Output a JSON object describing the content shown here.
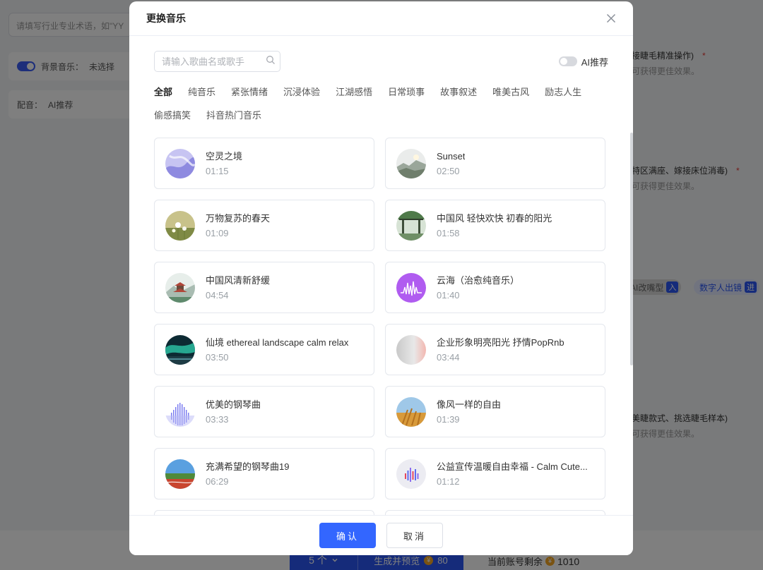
{
  "background": {
    "input_placeholder": "请填写行业专业术语，如\"YY",
    "music_label": "背景音乐：",
    "music_value": "未选择",
    "voice_label": "配音：",
    "voice_value": "AI推荐",
    "right_items": [
      {
        "text": "接睫毛精准操作)",
        "sub": "可获得更佳效果。"
      },
      {
        "text": "特区满座、嫁接床位消毒)",
        "sub": "可获得更佳效果。"
      },
      {
        "text": "美睫款式、挑选睫毛样本)",
        "sub": "可获得更佳效果。"
      }
    ],
    "tag_ai": "AI改嘴型",
    "tag_ai_badge": "入",
    "tag_digital": "数字人出镜",
    "tag_digital_badge": "进",
    "count_select": "5 个",
    "generate_label": "生成并预览",
    "generate_cost": "80",
    "balance_label": "当前账号剩余",
    "balance_value": "1010"
  },
  "modal": {
    "title": "更换音乐",
    "search_placeholder": "请输入歌曲名或歌手",
    "ai_recommend_label": "AI推荐",
    "ai_recommend_on": false,
    "categories": [
      "全部",
      "纯音乐",
      "紧张情绪",
      "沉浸体验",
      "江湖感悟",
      "日常琐事",
      "故事叙述",
      "唯美古风",
      "励志人生",
      "偷感搞笑",
      "抖音热门音乐"
    ],
    "active_category": "全部",
    "songs": [
      {
        "name": "空灵之境",
        "duration": "01:15",
        "cover": "ethereal"
      },
      {
        "name": "Sunset",
        "duration": "02:50",
        "cover": "sunset"
      },
      {
        "name": "万物复苏的春天",
        "duration": "01:09",
        "cover": "spring"
      },
      {
        "name": "中国风 轻快欢快 初春的阳光",
        "duration": "01:58",
        "cover": "pavilion"
      },
      {
        "name": "中国风清新舒缓",
        "duration": "04:54",
        "cover": "pagoda"
      },
      {
        "name": "云海（治愈纯音乐）",
        "duration": "01:40",
        "cover": "wave"
      },
      {
        "name": "仙境 ethereal landscape calm relax",
        "duration": "03:50",
        "cover": "aurora"
      },
      {
        "name": "企业形象明亮阳光 抒情PopRnb",
        "duration": "03:44",
        "cover": "gradient"
      },
      {
        "name": "优美的钢琴曲",
        "duration": "03:33",
        "cover": "piano"
      },
      {
        "name": "像风一样的自由",
        "duration": "01:39",
        "cover": "wheat"
      },
      {
        "name": "充满希望的钢琴曲19",
        "duration": "06:29",
        "cover": "field"
      },
      {
        "name": "公益宣传温暖自由幸福 - Calm Cute...",
        "duration": "01:12",
        "cover": "bars"
      },
      {
        "name": "",
        "duration": "",
        "cover": "blank"
      },
      {
        "name": "",
        "duration": "",
        "cover": "blank"
      }
    ],
    "confirm_label": "确认",
    "cancel_label": "取消",
    "colors": {
      "primary": "#3366ff",
      "accent_wave": "#b05cf0"
    }
  }
}
